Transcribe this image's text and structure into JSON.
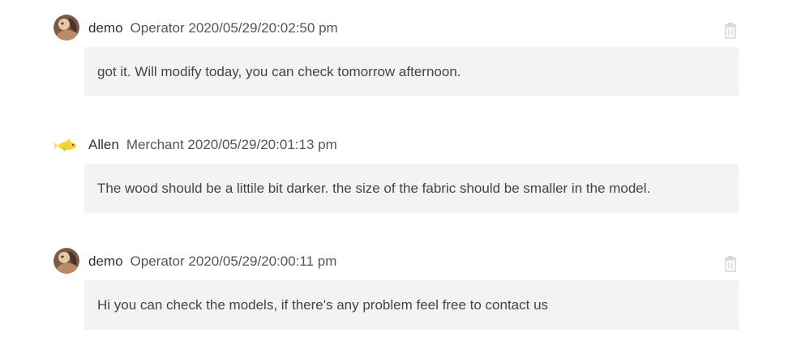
{
  "comments": [
    {
      "author": "demo",
      "role": "Operator",
      "timestamp": "2020/05/29/20:02:50 pm",
      "text": "got it. Will modify today, you can check tomorrow afternoon.",
      "avatar_icon": "user-avatar-photo",
      "deletable": true
    },
    {
      "author": "Allen",
      "role": "Merchant",
      "timestamp": "2020/05/29/20:01:13 pm",
      "text": "The wood should be a littile bit darker. the size of the fabric should be smaller in the model.",
      "avatar_icon": "goldfish-avatar",
      "deletable": false
    },
    {
      "author": "demo",
      "role": "Operator",
      "timestamp": "2020/05/29/20:00:11 pm",
      "text": "Hi you can check the models, if there's any problem feel free to contact us",
      "avatar_icon": "user-avatar-photo",
      "deletable": true
    }
  ],
  "colors": {
    "bubble_background": "#f2f3f4",
    "trash_icon": "#d5d7da",
    "text": "#444444"
  },
  "icons": {
    "delete": "trash-icon"
  }
}
